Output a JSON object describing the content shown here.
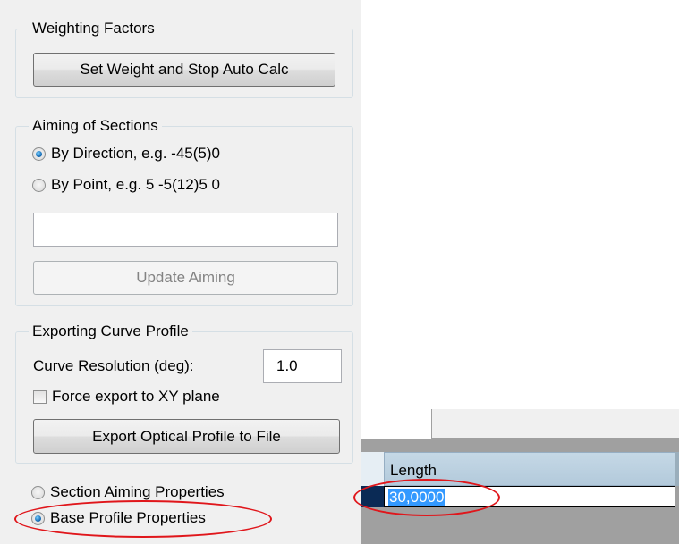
{
  "weighting": {
    "title": "Weighting Factors",
    "set_weight_button": "Set Weight and Stop Auto Calc"
  },
  "aiming": {
    "title": "Aiming of Sections",
    "by_direction": "By Direction, e.g. -45(5)0",
    "by_point": "By Point, e.g. 5 -5(12)5 0",
    "input_value": "",
    "update_button": "Update Aiming",
    "selected": "by_direction"
  },
  "exporting": {
    "title": "Exporting Curve Profile",
    "resolution_label": "Curve Resolution (deg):",
    "resolution_value": "1.0",
    "force_xy_label": "Force export to XY plane",
    "force_xy_checked": false,
    "export_button": "Export Optical Profile to File"
  },
  "properties": {
    "section_aiming": "Section Aiming Properties",
    "base_profile": "Base Profile Properties",
    "selected": "base_profile"
  },
  "grid": {
    "column_header": "Length",
    "cell_value": "30,0000"
  },
  "colors": {
    "annotation": "#e0161b",
    "selection": "#3399ff",
    "panel_bg": "#f0f0f0"
  }
}
